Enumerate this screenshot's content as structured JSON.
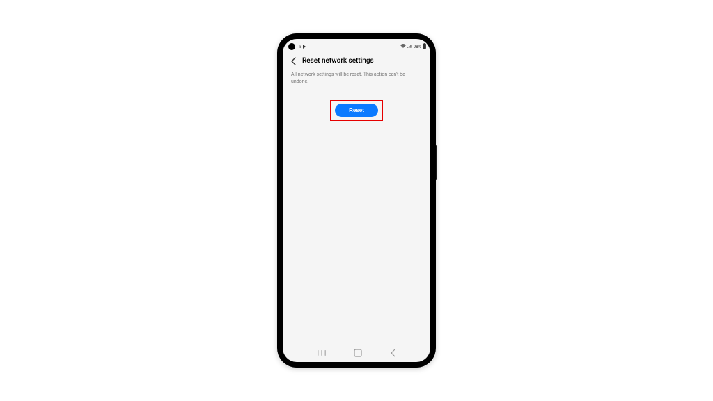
{
  "status": {
    "time_prefix": "5",
    "battery_text": "98%"
  },
  "header": {
    "title": "Reset network settings"
  },
  "body": {
    "description": "All network settings will be reset. This action can't be undone.",
    "reset_label": "Reset"
  }
}
